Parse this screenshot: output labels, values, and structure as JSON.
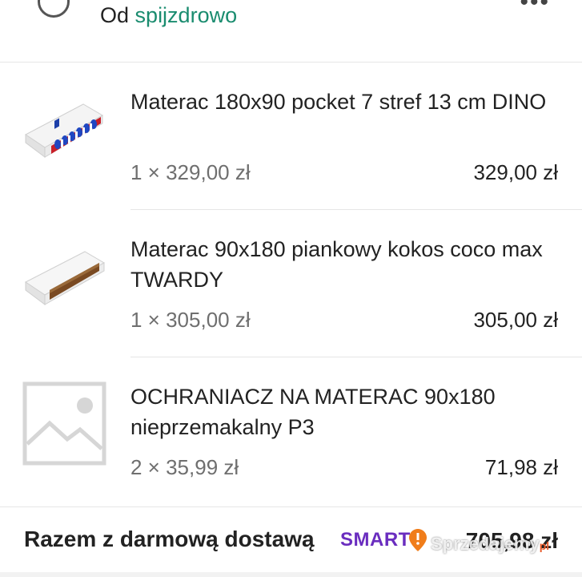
{
  "header": {
    "seller_prefix": "Od",
    "seller_name": "spijzdrowo",
    "more_icon": "more-horizontal-icon"
  },
  "items": [
    {
      "title": "Materac 180x90 pocket 7 stref 13 cm DINO",
      "qty": "1 × 329,00 zł",
      "price": "329,00 zł",
      "image": "mattress-pocket-image"
    },
    {
      "title": "Materac 90x180 piankowy kokos coco max TWARDY",
      "qty": "1 × 305,00 zł",
      "price": "305,00 zł",
      "image": "mattress-coconut-image"
    },
    {
      "title": "OCHRANIACZ NA MATERAC 90x180 nieprzemakalny P3",
      "qty": "2 × 35,99 zł",
      "price": "71,98 zł",
      "image": "placeholder-image"
    }
  ],
  "footer": {
    "total_label": "Razem z darmową dostawą",
    "smart_label": "SMART",
    "total_price": "705,98 zł"
  },
  "watermark": "Sprzedajemy",
  "watermark_suffix": "pl",
  "colors": {
    "accent_link": "#1a8c6f",
    "smart": "#6a2dbf",
    "smart_badge": "#f07d1a"
  }
}
